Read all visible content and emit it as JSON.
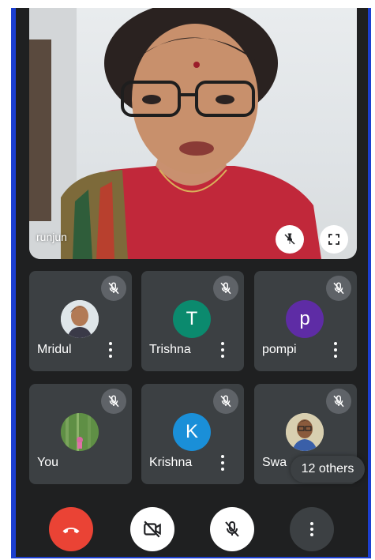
{
  "main_video": {
    "speaker_name": "runjun",
    "pin_icon": "unpin-icon",
    "fullscreen_icon": "fullscreen-icon"
  },
  "tiles": [
    {
      "name": "Mridul",
      "avatar_type": "photo",
      "avatar_letter": "",
      "muted": true
    },
    {
      "name": "Trishna",
      "avatar_type": "letter",
      "avatar_letter": "T",
      "avatar_color": "#0b8a6e",
      "muted": true
    },
    {
      "name": "pompi",
      "avatar_type": "letter",
      "avatar_letter": "p",
      "avatar_color": "#5e2ca5",
      "muted": true
    },
    {
      "name": "You",
      "avatar_type": "photo",
      "avatar_letter": "",
      "muted": true
    },
    {
      "name": "Krishna",
      "avatar_type": "letter",
      "avatar_letter": "K",
      "avatar_color": "#1a8fd8",
      "muted": true
    },
    {
      "name": "Swa",
      "avatar_type": "photo",
      "avatar_letter": "",
      "muted": true
    }
  ],
  "others_label": "12 others",
  "controls": {
    "end_call_icon": "end-call-icon",
    "camera_icon": "camera-off-icon",
    "mic_icon": "mic-off-icon",
    "more_icon": "more-options-icon"
  },
  "colors": {
    "frame_blue": "#1c3fd0",
    "end_call_red": "#ea4335",
    "tile_bg": "#3c4043",
    "screen_bg": "#1f2021"
  }
}
